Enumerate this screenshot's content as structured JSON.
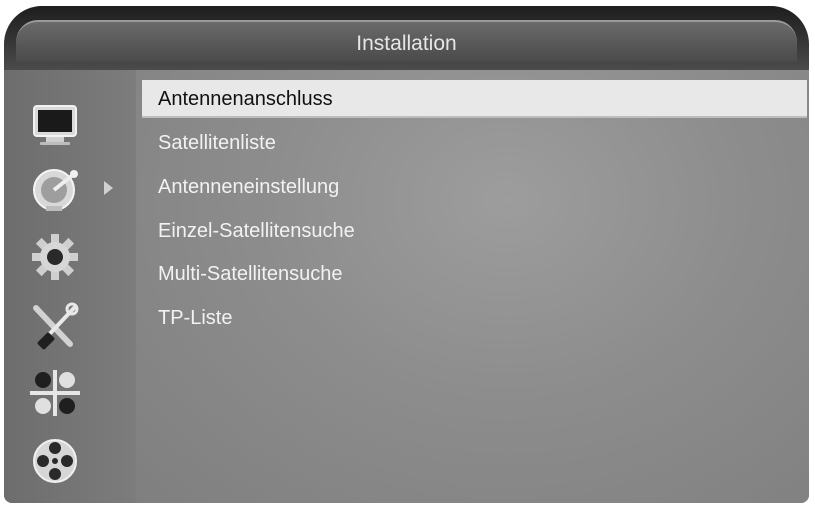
{
  "header": {
    "title": "Installation"
  },
  "sidebar": {
    "icons": [
      {
        "name": "tv-monitor-icon"
      },
      {
        "name": "satellite-dish-icon",
        "active": true
      },
      {
        "name": "gear-icon"
      },
      {
        "name": "tools-icon"
      },
      {
        "name": "mixer-balance-icon"
      },
      {
        "name": "film-reel-icon"
      }
    ]
  },
  "menu": {
    "selected_index": 0,
    "items": [
      {
        "label": "Antennenanschluss"
      },
      {
        "label": "Satellitenliste"
      },
      {
        "label": "Antenneneinstellung"
      },
      {
        "label": "Einzel-Satellitensuche"
      },
      {
        "label": "Multi-Satellitensuche"
      },
      {
        "label": "TP-Liste"
      }
    ]
  },
  "colors": {
    "selection_bg": "#e8e8e8",
    "selection_text": "#111111",
    "item_text": "#f2f2f2",
    "title_text": "#e6e6e6"
  }
}
